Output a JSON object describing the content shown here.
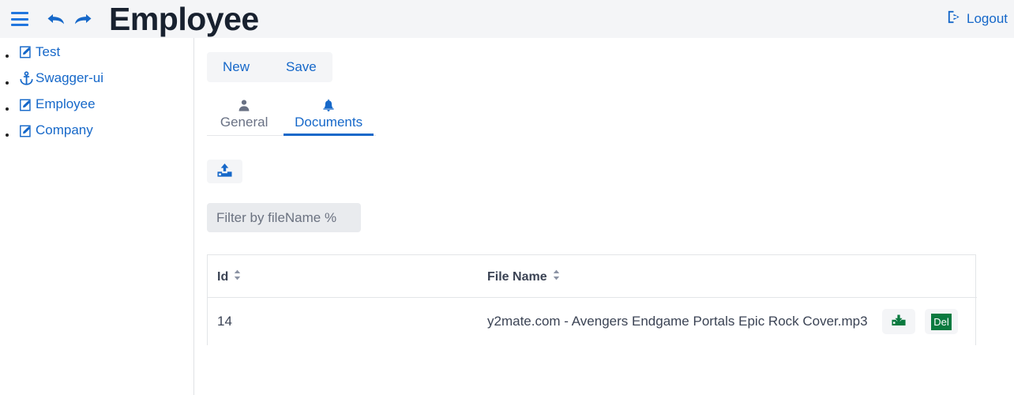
{
  "header": {
    "menu_icon": "hamburger-icon",
    "back_icon": "arrow-back-icon",
    "forward_icon": "arrow-forward-icon",
    "title": "Employee",
    "logout_label": "Logout",
    "logout_icon": "logout-icon",
    "accent_color": "#1668c9",
    "background": "#f4f5f7"
  },
  "sidebar": {
    "items": [
      {
        "label": "Test",
        "icon": "pencil-square-icon"
      },
      {
        "label": "Swagger-ui",
        "icon": "anchor-icon"
      },
      {
        "label": "Employee",
        "icon": "pencil-square-icon"
      },
      {
        "label": "Company",
        "icon": "pencil-square-icon"
      }
    ]
  },
  "toolbar": {
    "new_label": "New",
    "save_label": "Save"
  },
  "tabs": [
    {
      "label": "General",
      "icon": "user-icon",
      "active": false
    },
    {
      "label": "Documents",
      "icon": "bell-icon",
      "active": true
    }
  ],
  "documents": {
    "upload_icon": "upload-icon",
    "filter_placeholder": "Filter by fileName %",
    "filter_value": "",
    "columns": [
      {
        "label": "Id",
        "sortable": true
      },
      {
        "label": "File Name",
        "sortable": true
      },
      {
        "label": "",
        "sortable": false
      }
    ],
    "rows": [
      {
        "id": "14",
        "file_name": "y2mate.com - Avengers Endgame Portals Epic Rock Cover.mp3",
        "download_icon": "download-icon",
        "delete_label": "Del",
        "delete_icon": "delete-badge-icon"
      }
    ],
    "action_color": "#0a7a3f"
  }
}
